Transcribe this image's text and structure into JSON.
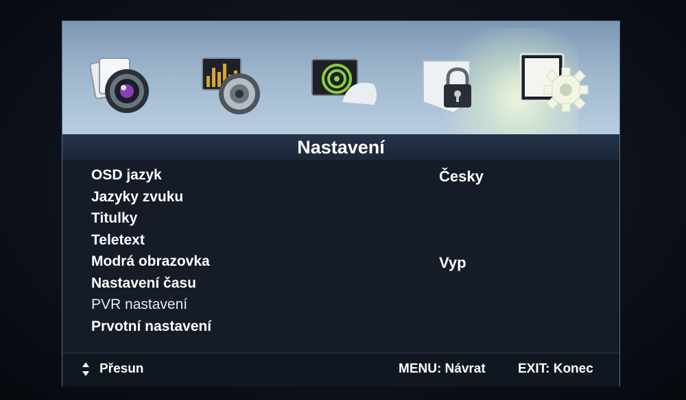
{
  "title": "Nastavení",
  "top_icons": [
    {
      "name": "picture-menu-icon"
    },
    {
      "name": "sound-menu-icon"
    },
    {
      "name": "channel-menu-icon"
    },
    {
      "name": "lock-menu-icon"
    },
    {
      "name": "settings-menu-icon",
      "selected": true
    }
  ],
  "menu": [
    {
      "label": "OSD jazyk",
      "value": "Česky"
    },
    {
      "label": "Jazyky zvuku",
      "value": ""
    },
    {
      "label": "Titulky",
      "value": ""
    },
    {
      "label": "Teletext",
      "value": ""
    },
    {
      "label": "Modrá obrazovka",
      "value": "Vyp"
    },
    {
      "label": "Nastavení času",
      "value": ""
    },
    {
      "label": "PVR nastavení",
      "value": ""
    },
    {
      "label": "Prvotní nastavení",
      "value": ""
    }
  ],
  "footer": {
    "move_icon": "up-down-arrows-icon",
    "move_label": "Přesun",
    "menu_hint": "MENU: Návrat",
    "exit_hint": "EXIT: Konec"
  },
  "colors": {
    "icon_bar": "#9db6cc",
    "title_bar": "#1f2d40",
    "panel": "#151c28",
    "text": "#ffffff"
  }
}
